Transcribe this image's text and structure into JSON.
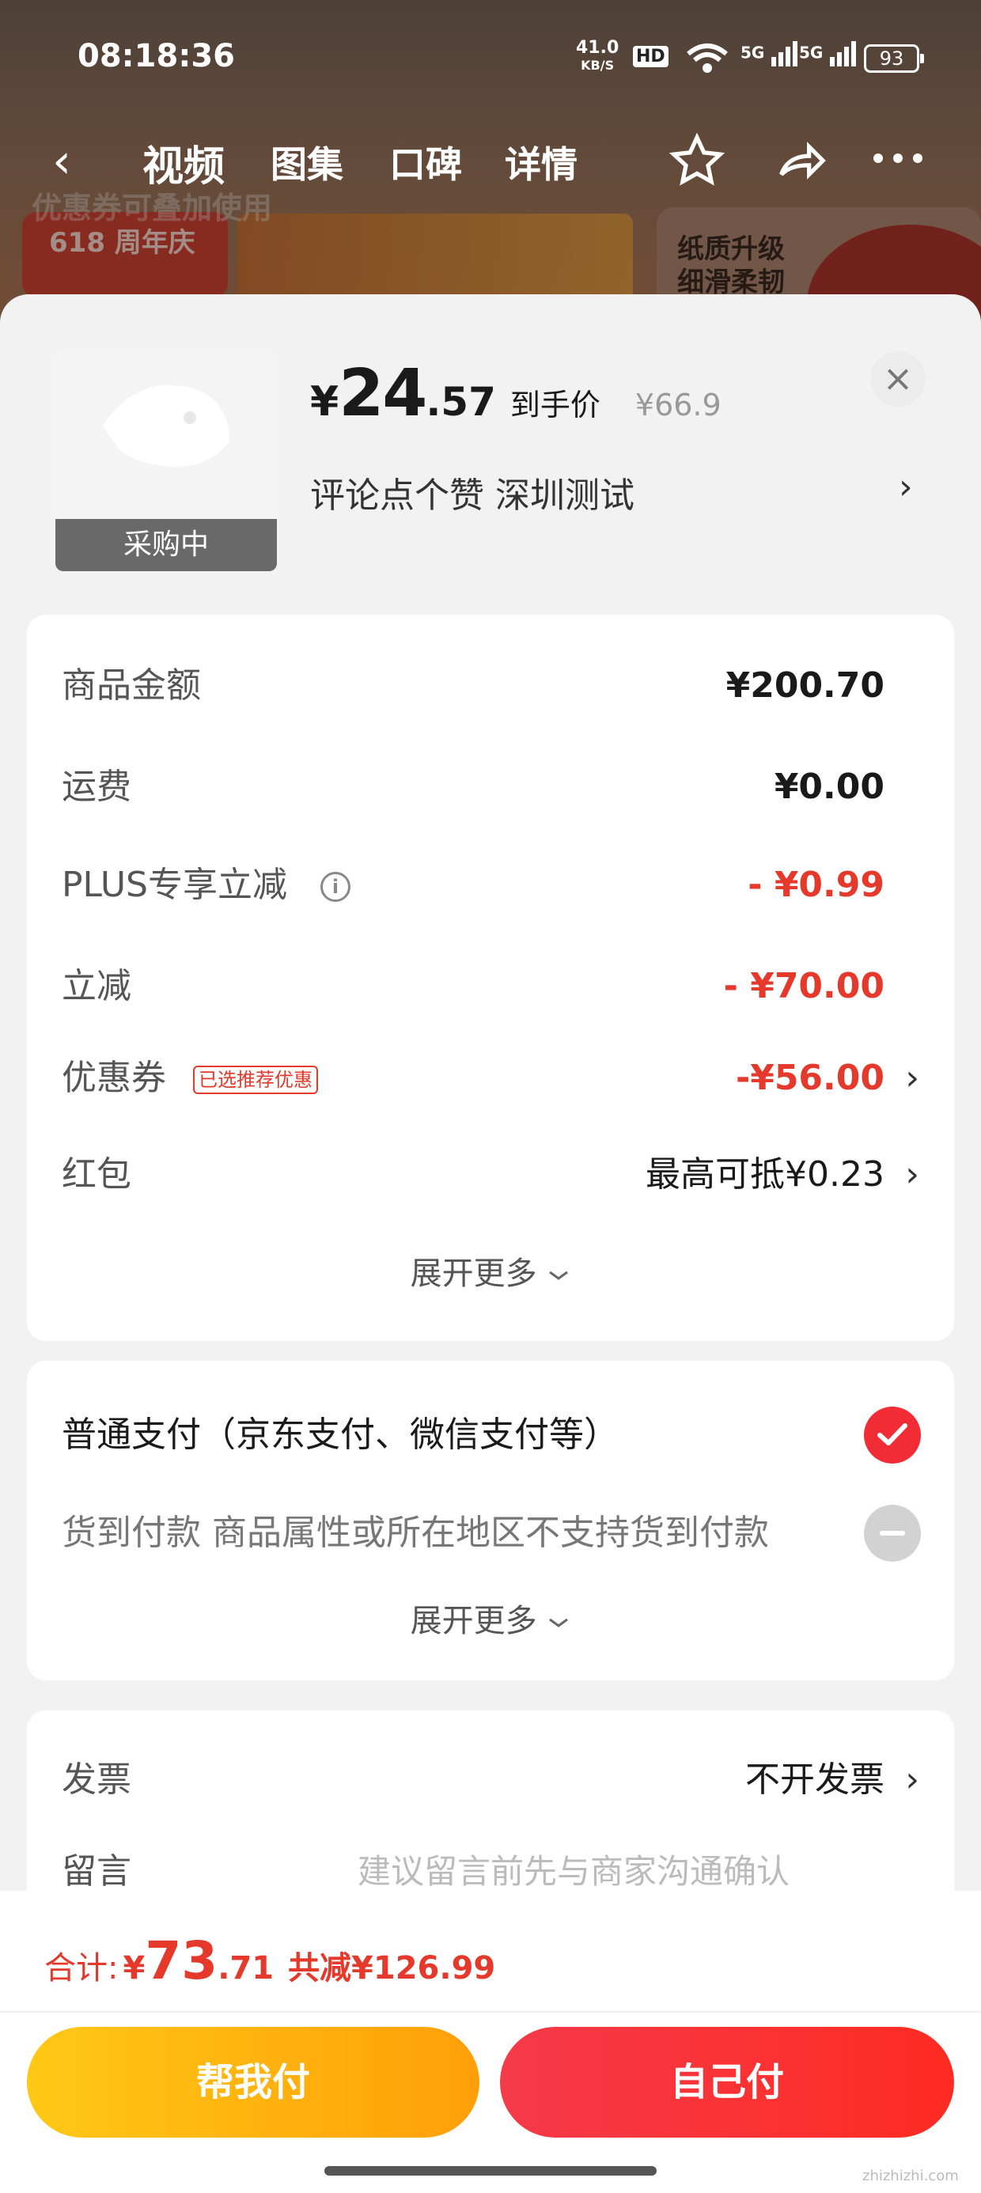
{
  "status_bar": {
    "time": "08:18:36",
    "net_speed": "41.0",
    "net_unit": "KB/S",
    "hd": "HD",
    "sig1": "5G",
    "sig2": "5G",
    "battery": "93"
  },
  "background": {
    "tabs": [
      "视频",
      "图集",
      "口碑",
      "详情"
    ],
    "banner_badge": "618 周年庆",
    "banner_right": "纸质升级 细滑柔韧",
    "coupon_hint": "优惠券可叠加使用"
  },
  "product": {
    "thumb_status": "采购中",
    "price_symbol": "¥",
    "price_int": "24",
    "price_dec": ".57",
    "price_label": "到手价",
    "original_price": "¥66.9",
    "spec": "评论点个赞  深圳测试",
    "close_glyph": "×"
  },
  "summary": {
    "rows": [
      {
        "label": "商品金额",
        "value": "¥200.70"
      },
      {
        "label": "运费",
        "value": "¥0.00"
      },
      {
        "label": "PLUS专享立减",
        "value": "- ¥0.99"
      },
      {
        "label": "立减",
        "value": "- ¥70.00"
      },
      {
        "label": "优惠券",
        "tag": "已选推荐优惠",
        "value": "-¥56.00"
      },
      {
        "label": "红包",
        "value": "最高可抵¥0.23"
      }
    ],
    "expand": "展开更多"
  },
  "payment": {
    "normal": "普通支付（京东支付、微信支付等）",
    "cod": "货到付款  商品属性或所在地区不支持货到付款",
    "expand": "展开更多"
  },
  "extras": {
    "invoice_label": "发票",
    "invoice_value": "不开发票",
    "remark_label": "留言",
    "remark_placeholder": "建议留言前先与商家沟通确认"
  },
  "footer": {
    "total_label": "合计:",
    "total_symbol": "¥",
    "total_int": "73",
    "total_dec": ".71",
    "total_saved": "共减¥126.99",
    "help_pay": "帮我付",
    "self_pay": "自己付",
    "watermark": "zhizhizhi.com"
  },
  "colors": {
    "accent_red": "#e4392b",
    "check_red": "#f22c35",
    "help_yellow": "#ffb812",
    "self_red": "#f5303a"
  }
}
